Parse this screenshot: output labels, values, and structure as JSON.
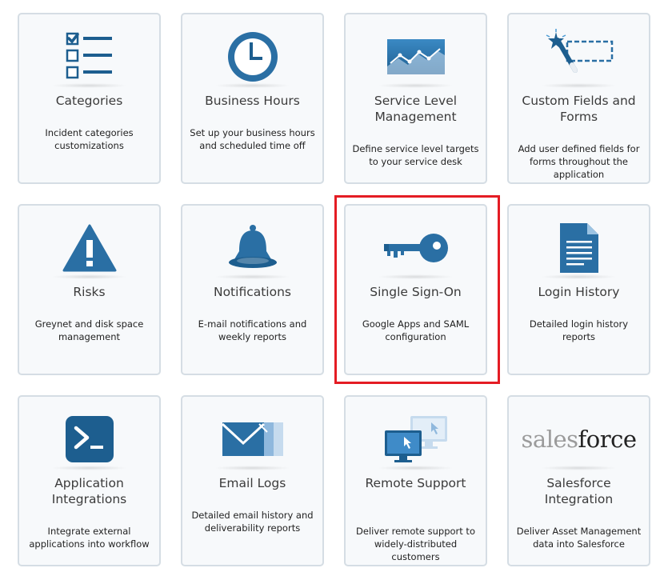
{
  "colors": {
    "icon_blue": "#2a6fa4",
    "icon_dark_blue": "#1d5e8f",
    "tile_background": "#f7f9fb",
    "tile_border": "#d5dde4",
    "highlight": "#e41c24"
  },
  "tiles": [
    {
      "title": "Categories",
      "description": "Incident categories customizations",
      "icon": "checklist-icon"
    },
    {
      "title": "Business Hours",
      "description": "Set up your business hours and scheduled time off",
      "icon": "clock-icon"
    },
    {
      "title": "Service Level Management",
      "description": "Define service level targets to your service desk",
      "icon": "line-graph-icon"
    },
    {
      "title": "Custom Fields and Forms",
      "description": "Add user defined fields for forms throughout the application",
      "icon": "magic-wand-icon"
    },
    {
      "title": "Risks",
      "description": "Greynet and disk space management",
      "icon": "warning-icon"
    },
    {
      "title": "Notifications",
      "description": "E-mail notifications and weekly reports",
      "icon": "bell-icon"
    },
    {
      "title": "Single Sign-On",
      "description": "Google Apps and SAML configuration",
      "icon": "key-icon",
      "highlighted": true
    },
    {
      "title": "Login History",
      "description": "Detailed login history reports",
      "icon": "document-icon"
    },
    {
      "title": "Application Integrations",
      "description": "Integrate external applications into workflow",
      "icon": "terminal-icon"
    },
    {
      "title": "Email Logs",
      "description": "Detailed email history and deliverability reports",
      "icon": "envelopes-icon"
    },
    {
      "title": "Remote Support",
      "description": "Deliver remote support to widely-distributed customers",
      "icon": "monitors-icon"
    },
    {
      "title": "Salesforce Integration",
      "description": "Deliver Asset Management data into Salesforce",
      "icon": "salesforce-logo",
      "logo_text_a": "sales",
      "logo_text_b": "force"
    }
  ]
}
